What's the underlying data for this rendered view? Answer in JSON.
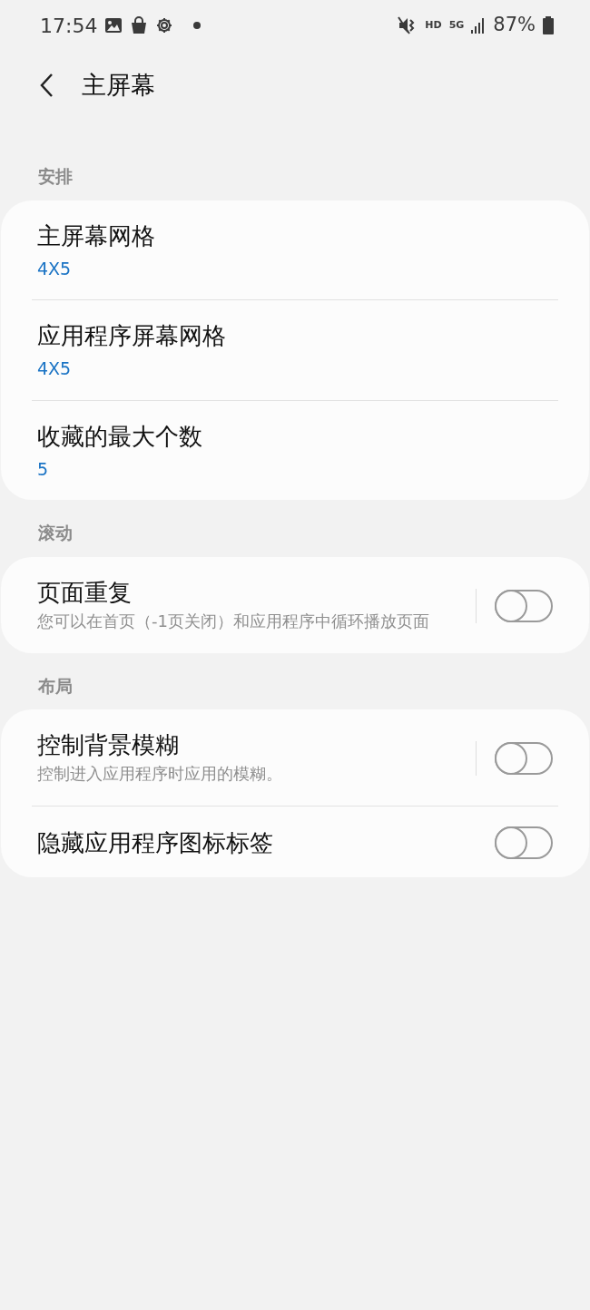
{
  "status_bar": {
    "time": "17:54",
    "network": "HD",
    "network_type": "5G",
    "battery": "87%"
  },
  "header": {
    "title": "主屏幕"
  },
  "sections": [
    {
      "title": "安排",
      "items": [
        {
          "kind": "value",
          "title": "主屏幕网格",
          "value": "4X5"
        },
        {
          "kind": "value",
          "title": "应用程序屏幕网格",
          "value": "4X5"
        },
        {
          "kind": "value",
          "title": "收藏的最大个数",
          "value": "5"
        }
      ]
    },
    {
      "title": "滚动",
      "items": [
        {
          "kind": "switch",
          "title": "页面重复",
          "description": "您可以在首页（-1页关闭）和应用程序中循环播放页面",
          "on": false
        }
      ]
    },
    {
      "title": "布局",
      "items": [
        {
          "kind": "switch",
          "title": "控制背景模糊",
          "description": "控制进入应用程序时应用的模糊。",
          "on": false
        },
        {
          "kind": "switch",
          "title": "隐藏应用程序图标标签",
          "on": false
        }
      ]
    }
  ]
}
